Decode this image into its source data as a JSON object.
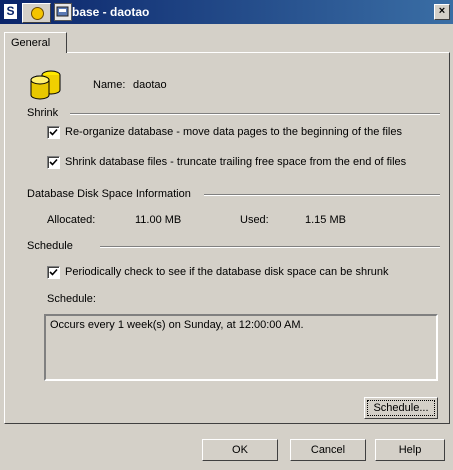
{
  "window": {
    "title_prefix": "S",
    "title": "base - daotao",
    "close_glyph": "×"
  },
  "tabs": [
    {
      "label": "General"
    }
  ],
  "name_row": {
    "label": "Name:",
    "value": "daotao",
    "icon": "database-icon"
  },
  "shrink": {
    "heading": "Shrink",
    "options": [
      {
        "label": "Re-organize database - move data pages to the beginning of the files",
        "checked": true
      },
      {
        "label": "Shrink database files - truncate trailing free space from the end of files",
        "checked": true
      }
    ]
  },
  "disk_space": {
    "heading": "Database Disk Space Information",
    "allocated_label": "Allocated:",
    "allocated_value": "11.00 MB",
    "used_label": "Used:",
    "used_value": "1.15 MB"
  },
  "schedule": {
    "heading": "Schedule",
    "periodic_label": "Periodically check to see if the database disk space can be shrunk",
    "periodic_checked": true,
    "schedule_label": "Schedule:",
    "schedule_text": "Occurs every 1 week(s) on Sunday, at 12:00:00 AM.",
    "schedule_button": "Schedule..."
  },
  "buttons": {
    "ok": "OK",
    "cancel": "Cancel",
    "help": "Help"
  },
  "colors": {
    "titlebar_start": "#0a246a",
    "titlebar_end": "#3a6ea5",
    "dialog_bg": "#d4d0c8"
  }
}
